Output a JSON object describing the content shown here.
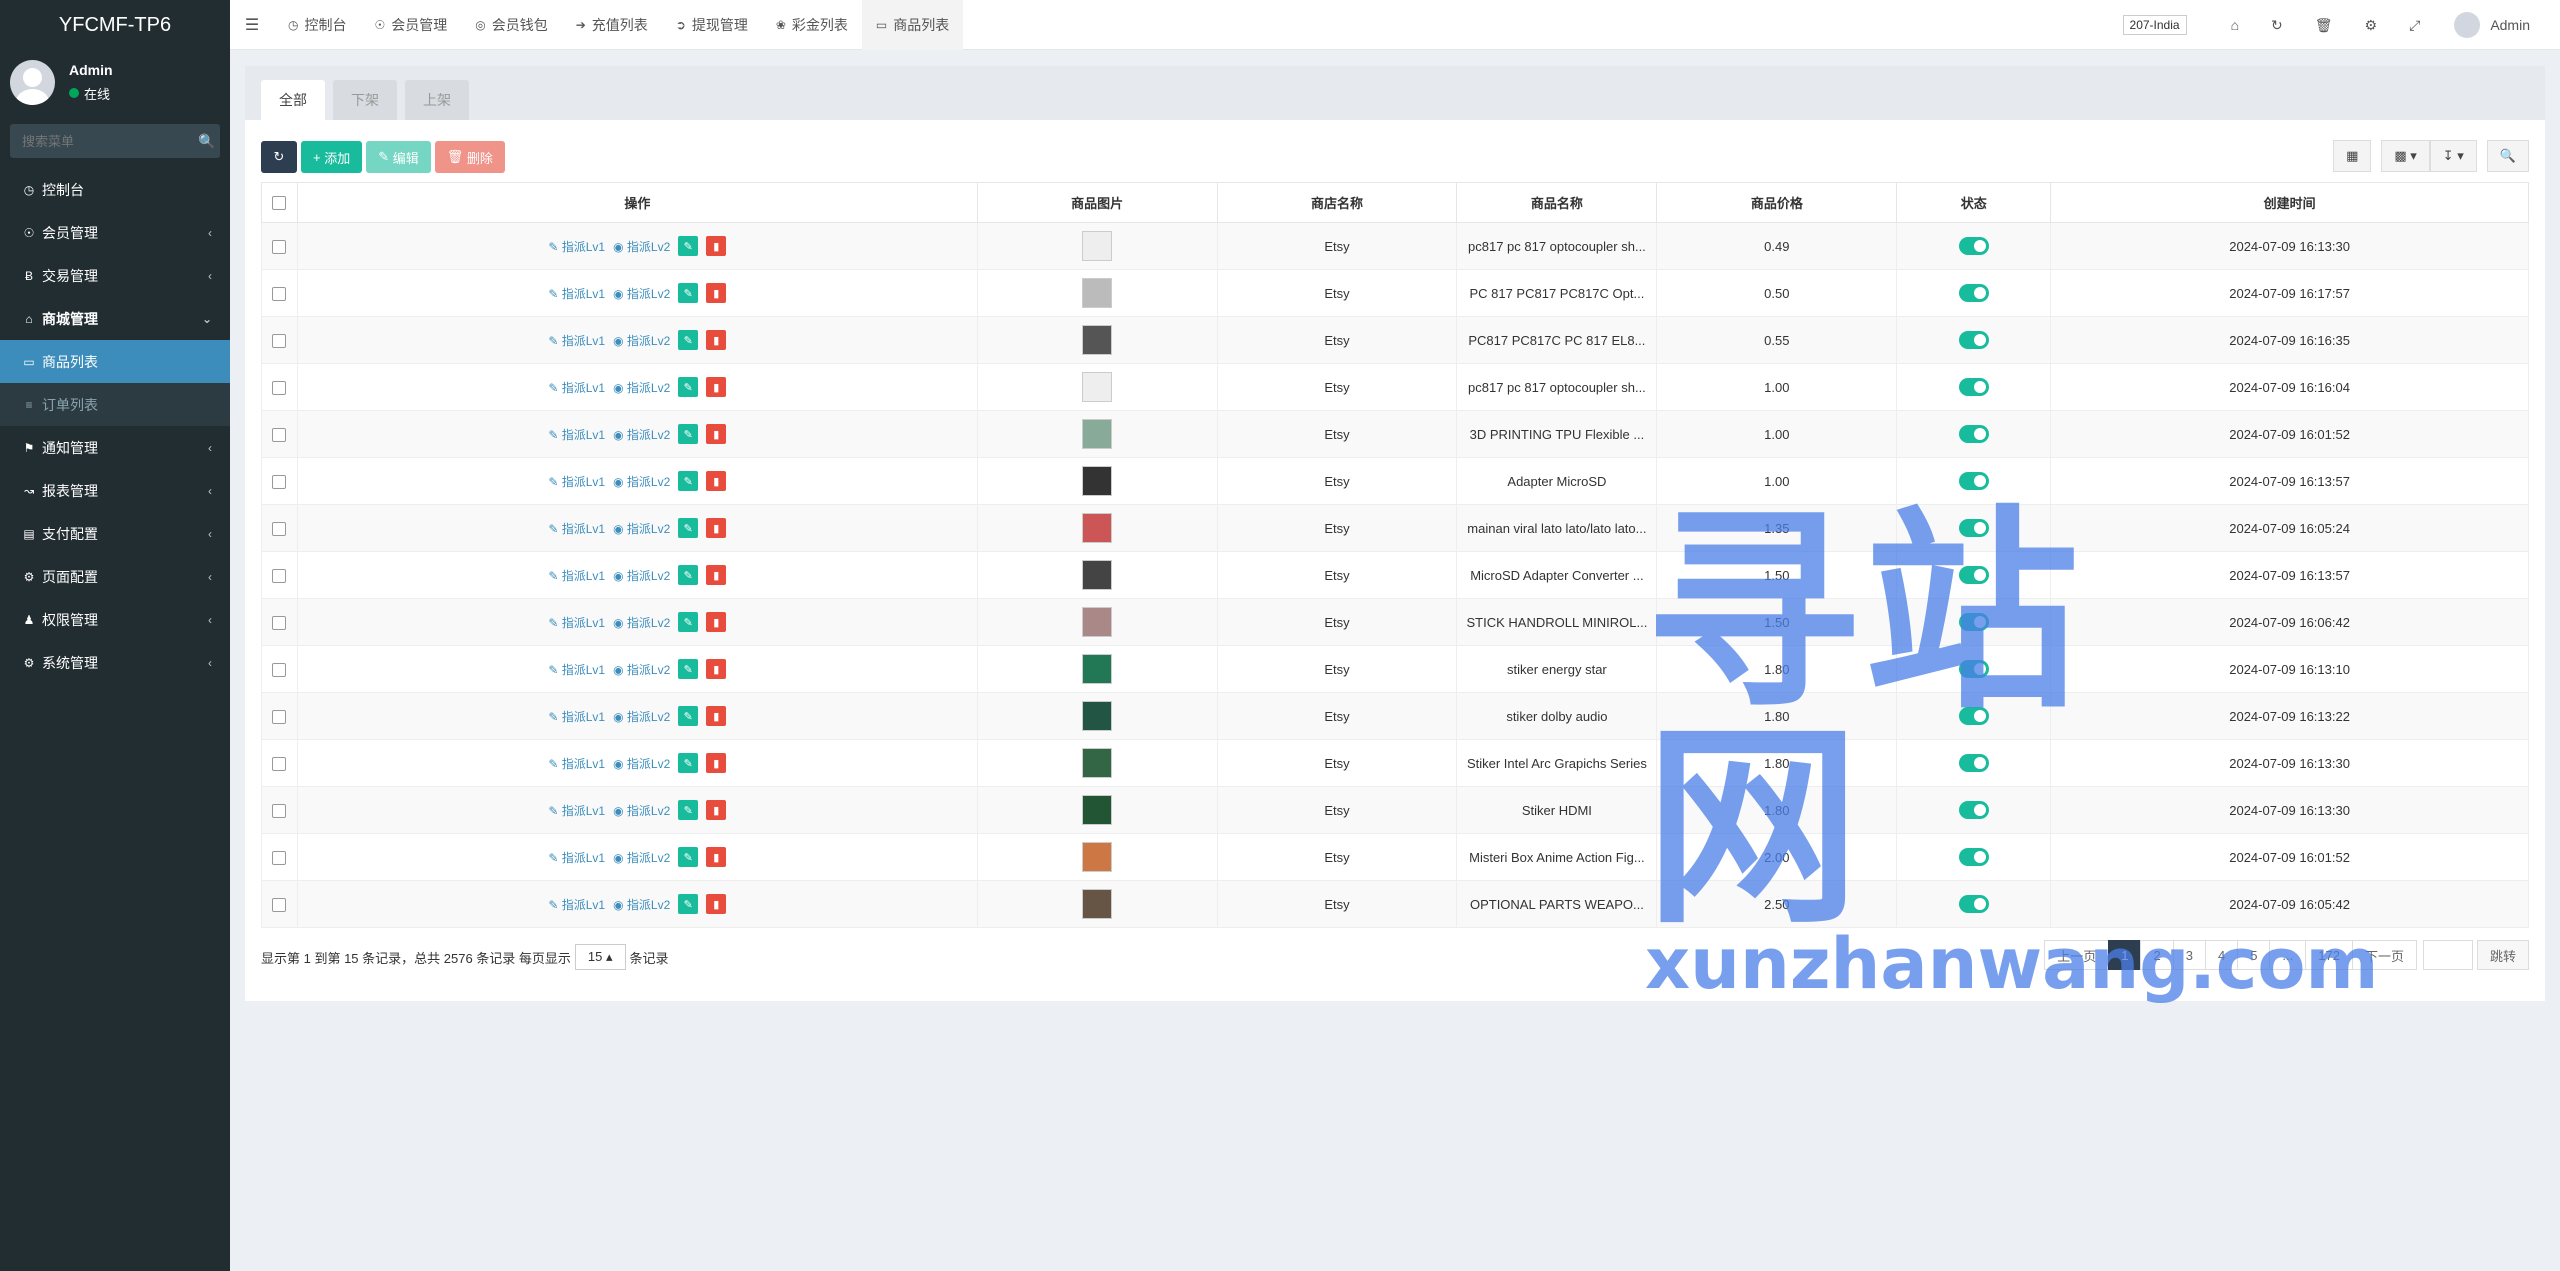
{
  "app": {
    "logo": "YFCMF-TP6"
  },
  "user": {
    "name": "Admin",
    "status": "在线"
  },
  "search": {
    "placeholder": "搜索菜单"
  },
  "sidebar": {
    "items": [
      {
        "label": "控制台",
        "icon": "dashboard-icon"
      },
      {
        "label": "会员管理",
        "icon": "user-icon"
      },
      {
        "label": "交易管理",
        "icon": "bitcoin-icon"
      },
      {
        "label": "商城管理",
        "icon": "home-icon"
      },
      {
        "label": "商品列表",
        "icon": "desktop-icon"
      },
      {
        "label": "订单列表",
        "icon": "list-icon"
      },
      {
        "label": "通知管理",
        "icon": "bell-icon"
      },
      {
        "label": "报表管理",
        "icon": "chart-icon"
      },
      {
        "label": "支付配置",
        "icon": "card-icon"
      },
      {
        "label": "页面配置",
        "icon": "gear-icon"
      },
      {
        "label": "权限管理",
        "icon": "group-icon"
      },
      {
        "label": "系统管理",
        "icon": "cogs-icon"
      }
    ]
  },
  "topnav": {
    "tabs": [
      {
        "label": "控制台",
        "icon": "dashboard-icon"
      },
      {
        "label": "会员管理",
        "icon": "user-icon"
      },
      {
        "label": "会员钱包",
        "icon": "wallet-icon"
      },
      {
        "label": "充值列表",
        "icon": "signin-icon"
      },
      {
        "label": "提现管理",
        "icon": "signout-icon"
      },
      {
        "label": "彩金列表",
        "icon": "gift-icon"
      },
      {
        "label": "商品列表",
        "icon": "desktop-icon"
      }
    ],
    "lang": "207-India",
    "admin": "Admin"
  },
  "filter_tabs": [
    "全部",
    "下架",
    "上架"
  ],
  "toolbar": {
    "add": "添加",
    "edit": "编辑",
    "delete": "删除"
  },
  "table": {
    "headers": [
      "操作",
      "商品图片",
      "商店名称",
      "商品名称",
      "商品价格",
      "状态",
      "创建时间"
    ],
    "op_labels": {
      "lv1": "指派Lv1",
      "lv2": "指派Lv2"
    },
    "rows": [
      {
        "store": "Etsy",
        "name": "pc817 pc 817 optocoupler sh...",
        "price": "0.49",
        "time": "2024-07-09 16:13:30"
      },
      {
        "store": "Etsy",
        "name": "PC 817 PC817 PC817C Opt...",
        "price": "0.50",
        "time": "2024-07-09 16:17:57"
      },
      {
        "store": "Etsy",
        "name": "PC817 PC817C PC 817 EL8...",
        "price": "0.55",
        "time": "2024-07-09 16:16:35"
      },
      {
        "store": "Etsy",
        "name": "pc817 pc 817 optocoupler sh...",
        "price": "1.00",
        "time": "2024-07-09 16:16:04"
      },
      {
        "store": "Etsy",
        "name": "3D PRINTING TPU Flexible ...",
        "price": "1.00",
        "time": "2024-07-09 16:01:52"
      },
      {
        "store": "Etsy",
        "name": "Adapter MicroSD",
        "price": "1.00",
        "time": "2024-07-09 16:13:57"
      },
      {
        "store": "Etsy",
        "name": "mainan viral lato lato/lato lato...",
        "price": "1.35",
        "time": "2024-07-09 16:05:24"
      },
      {
        "store": "Etsy",
        "name": "MicroSD Adapter Converter ...",
        "price": "1.50",
        "time": "2024-07-09 16:13:57"
      },
      {
        "store": "Etsy",
        "name": "STICK HANDROLL MINIROL...",
        "price": "1.50",
        "time": "2024-07-09 16:06:42"
      },
      {
        "store": "Etsy",
        "name": "stiker energy star",
        "price": "1.80",
        "time": "2024-07-09 16:13:10"
      },
      {
        "store": "Etsy",
        "name": "stiker dolby audio",
        "price": "1.80",
        "time": "2024-07-09 16:13:22"
      },
      {
        "store": "Etsy",
        "name": "Stiker Intel Arc Grapichs Series",
        "price": "1.80",
        "time": "2024-07-09 16:13:30"
      },
      {
        "store": "Etsy",
        "name": "Stiker HDMI",
        "price": "1.80",
        "time": "2024-07-09 16:13:30"
      },
      {
        "store": "Etsy",
        "name": "Misteri Box Anime Action Fig...",
        "price": "2.00",
        "time": "2024-07-09 16:01:52"
      },
      {
        "store": "Etsy",
        "name": "OPTIONAL PARTS WEAPO...",
        "price": "2.50",
        "time": "2024-07-09 16:05:42"
      }
    ]
  },
  "pager": {
    "summary": "显示第 1 到第 15 条记录，总共 2576 条记录 每页显示",
    "pagesize": "15",
    "suffix": "条记录",
    "prev": "上一页",
    "pages": [
      "1",
      "2",
      "3",
      "4",
      "5",
      "...",
      "172"
    ],
    "next": "下一页",
    "go": "跳转"
  },
  "watermark": {
    "main": "寻站网",
    "sub": "xunzhanwang.com"
  },
  "colors": {
    "sidebar": "#222d32",
    "active": "#3c8dbc",
    "green": "#18bc9c",
    "red": "#e74c3c",
    "dark": "#2c3e50"
  }
}
